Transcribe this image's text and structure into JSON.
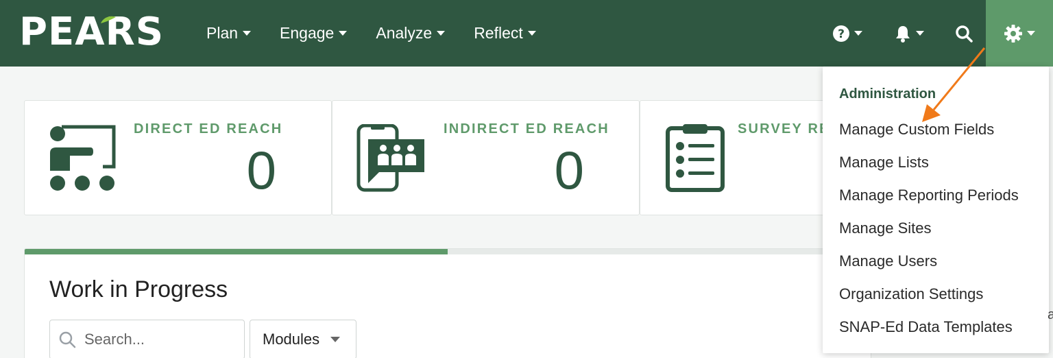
{
  "app": {
    "logo_text": "PEARS"
  },
  "nav": {
    "items": [
      {
        "label": "Plan"
      },
      {
        "label": "Engage"
      },
      {
        "label": "Analyze"
      },
      {
        "label": "Reflect"
      }
    ],
    "icons": [
      "help-icon",
      "bell-icon",
      "search-icon",
      "gear-icon"
    ]
  },
  "cards": [
    {
      "label": "DIRECT ED REACH",
      "value": "0",
      "icon": "presenter-icon"
    },
    {
      "label": "INDIRECT ED REACH",
      "value": "0",
      "icon": "phone-group-icon"
    },
    {
      "label": "SURVEY RE",
      "icon": "clipboard-list-icon"
    }
  ],
  "wip": {
    "title": "Work in Progress",
    "progress": 0.5,
    "search_placeholder": "Search...",
    "modules_label": "Modules"
  },
  "dropdown": {
    "header": "Administration",
    "items": [
      "Manage Custom Fields",
      "Manage Lists",
      "Manage Reporting Periods",
      "Manage Sites",
      "Manage Users",
      "Organization Settings",
      "SNAP-Ed Data Templates"
    ]
  },
  "edge_text": "a",
  "colors": {
    "nav_bg": "#2f5741",
    "accent": "#5e9a6a",
    "label_green": "#5f9a6b",
    "annotation_arrow": "#f07a1a"
  }
}
